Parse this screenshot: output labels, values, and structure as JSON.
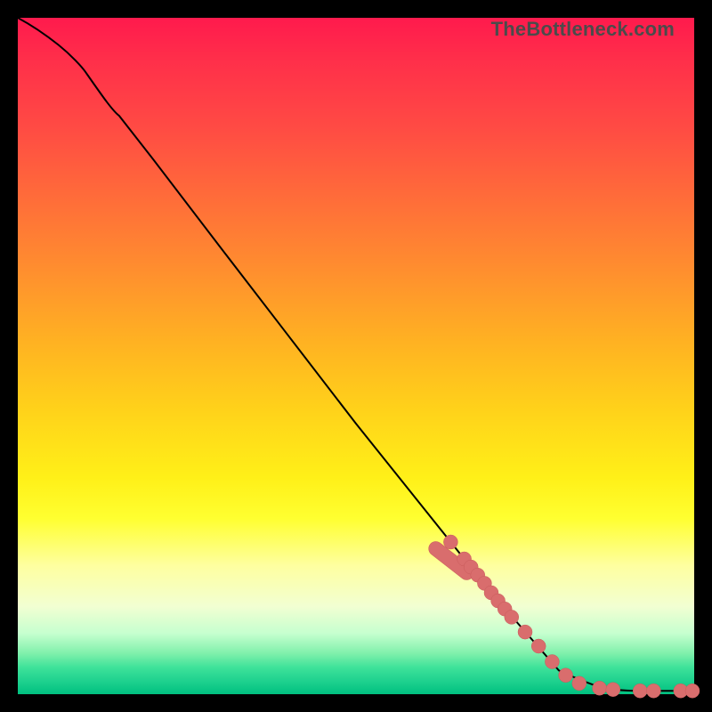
{
  "watermark": "TheBottleneck.com",
  "colors": {
    "background": "#000000",
    "gradient_top": "#ff1a4d",
    "gradient_mid": "#ffd21a",
    "gradient_bottom": "#00c080",
    "curve": "#000000",
    "marker": "#d96d6d"
  },
  "chart_data": {
    "type": "line",
    "title": "",
    "xlabel": "",
    "ylabel": "",
    "xlim": [
      0,
      100
    ],
    "ylim": [
      0,
      100
    ],
    "x": [
      0,
      3,
      6,
      10,
      15,
      20,
      30,
      40,
      50,
      60,
      70,
      80,
      88,
      90,
      92,
      95,
      100
    ],
    "values": [
      100,
      98.5,
      96,
      92,
      85.5,
      79,
      66,
      53,
      40,
      27.5,
      15,
      3.5,
      0.7,
      0.5,
      0.5,
      0.5,
      0.5
    ],
    "series": [
      {
        "name": "curve",
        "x": [
          0,
          3,
          6,
          10,
          15,
          20,
          30,
          40,
          50,
          60,
          70,
          80,
          88,
          90,
          92,
          95,
          100
        ],
        "values": [
          100,
          98.5,
          96,
          92,
          85.5,
          79,
          66,
          53,
          40,
          27.5,
          15,
          3.5,
          0.7,
          0.5,
          0.5,
          0.5,
          0.5
        ]
      },
      {
        "name": "markers",
        "x": [
          64,
          66,
          67,
          68,
          69,
          70,
          71,
          72,
          73,
          75,
          77,
          79,
          81,
          83,
          86,
          88,
          92,
          94,
          98,
          100
        ],
        "values": [
          22.5,
          20,
          18.8,
          17.6,
          16.4,
          15,
          13.8,
          12.6,
          11.4,
          9.2,
          7.1,
          4.8,
          2.8,
          1.6,
          0.9,
          0.7,
          0.5,
          0.5,
          0.5,
          0.5
        ]
      }
    ]
  }
}
